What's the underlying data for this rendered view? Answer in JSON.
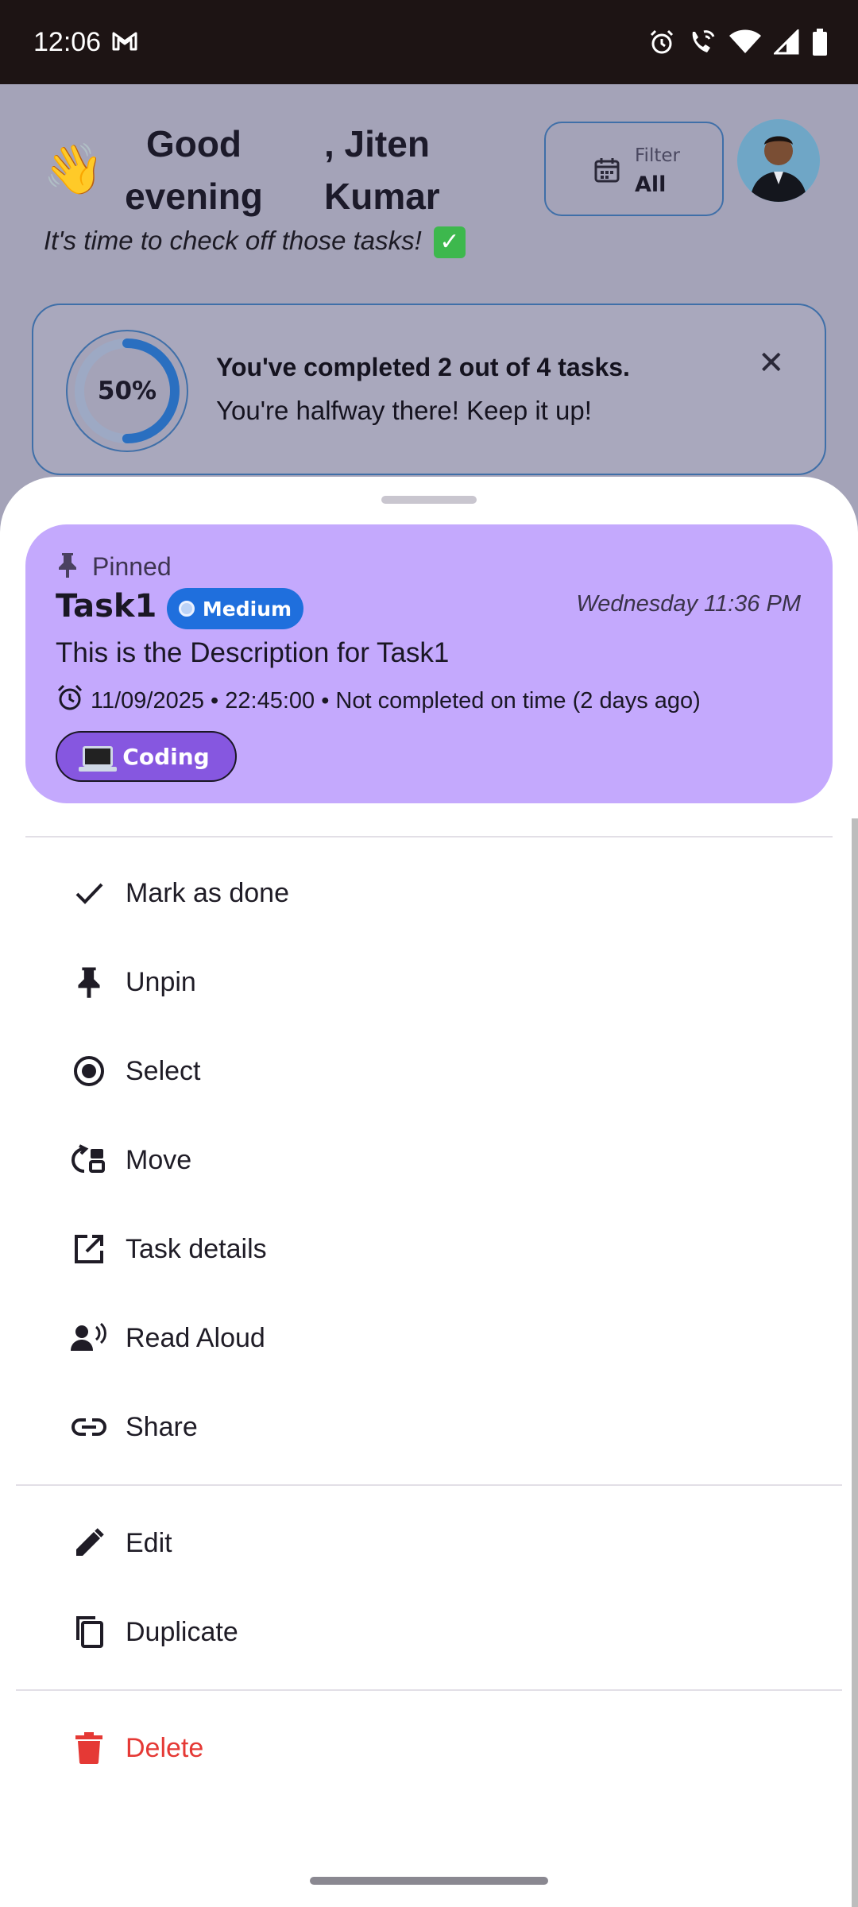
{
  "status_bar": {
    "time": "12:06",
    "gmail_icon": "gmail-icon",
    "icons": [
      "alarm-icon",
      "wifi-calling-icon",
      "wifi-icon",
      "cell-signal-icon",
      "battery-icon"
    ]
  },
  "header": {
    "wave_emoji": "👋",
    "greeting_part1": "Good evening",
    "greeting_part2": ", Jiten Kumar",
    "subtitle": "It's time to check off those tasks!",
    "check_emoji": "✓",
    "filter_label": "Filter",
    "filter_value": "All"
  },
  "progress": {
    "percent_text": "50%",
    "percent": 50,
    "title": "You've completed 2 out of 4 tasks.",
    "subtitle": "You're halfway there! Keep it up!",
    "close_icon": "close-icon"
  },
  "task": {
    "pinned_label": "Pinned",
    "title": "Task1",
    "priority": "Medium",
    "date": "Wednesday 11:36 PM",
    "description": "This is the Description for Task1",
    "due_text": "11/09/2025 • 22:45:00 • Not completed on time (2 days ago)",
    "category": "Coding",
    "card_color": "#c4a9fd",
    "priority_color": "#1f6fdd"
  },
  "menu": {
    "mark_done": "Mark as done",
    "unpin": "Unpin",
    "select": "Select",
    "move": "Move",
    "details": "Task details",
    "read_aloud": "Read Aloud",
    "share": "Share",
    "edit": "Edit",
    "duplicate": "Duplicate",
    "delete": "Delete"
  },
  "colors": {
    "delete": "#e53935",
    "accent": "#1f6fdd"
  }
}
